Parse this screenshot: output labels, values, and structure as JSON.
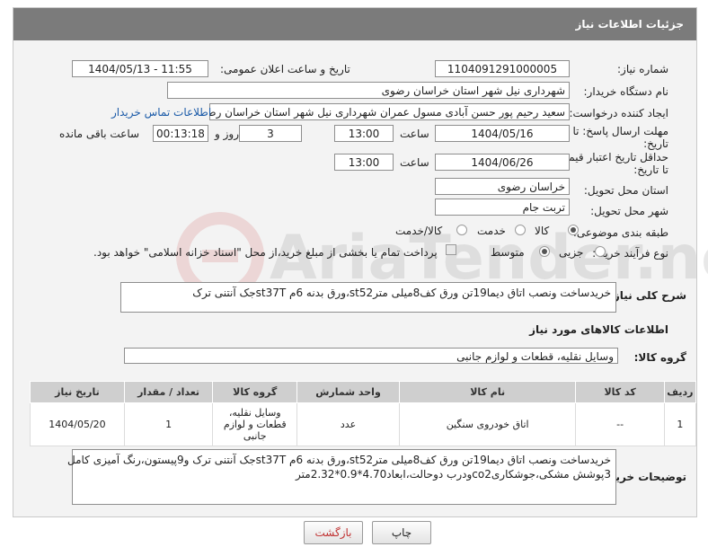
{
  "header": {
    "title": "جزئیات اطلاعات نیاز"
  },
  "fields": {
    "need_number_label": "شماره نیاز:",
    "need_number": "1104091291000005",
    "announce_label": "تاریخ و ساعت اعلان عمومی:",
    "announce_value": "1404/05/13 - 11:55",
    "buyer_org_label": "نام دستگاه خریدار:",
    "buyer_org": "شهرداری نیل شهر استان خراسان رضوی",
    "creator_label": "ایجاد کننده درخواست:",
    "creator": "سعید رحیم پور حسن آبادی مسول عمران شهرداری نیل شهر استان خراسان رضوی",
    "contact_link": "اطلاعات تماس خریدار",
    "reply_deadline_label_1": "مهلت ارسال پاسخ: تا",
    "reply_deadline_label_2": "تاریخ:",
    "reply_date": "1404/05/16",
    "time_label": "ساعت",
    "reply_time": "13:00",
    "days_value": "3",
    "days_label": "روز و",
    "remaining_value": "00:13:18",
    "remaining_label": "ساعت باقی مانده",
    "price_deadline_label_1": "حداقل تاریخ اعتبار قیمت:",
    "price_deadline_label_2": "تا تاریخ:",
    "price_date": "1404/06/26",
    "price_time": "13:00",
    "province_label": "استان محل تحویل:",
    "province": "خراسان رضوی",
    "city_label": "شهر محل تحویل:",
    "city": "تربت جام",
    "category_label": "طبقه بندی موضوعی:",
    "category_options": [
      "کالا",
      "خدمت",
      "کالا/خدمت"
    ],
    "process_label": "نوع فرآیند خرید :",
    "process_options": [
      "جزیی",
      "متوسط"
    ],
    "payment_note": "پرداخت تمام یا بخشی از مبلغ خرید،از محل \"اسناد خزانه اسلامی\" خواهد بود."
  },
  "summary": {
    "label": "شرح کلی نیاز:",
    "text": "خریدساخت ونصب اتاق دیما19تن ورق کف8میلی مترst52،ورق بدنه 6م st37Tجک آنتنی ترک"
  },
  "goods": {
    "section_title": "اطلاعات کالاهای مورد نیاز",
    "group_label": "گروه کالا:",
    "group_value": "وسایل نقلیه، قطعات و لوازم جانبی",
    "columns": [
      "ردیف",
      "کد کالا",
      "نام کالا",
      "واحد شمارش",
      "گروه کالا",
      "تعداد / مقدار",
      "تاریخ نیاز"
    ],
    "rows": [
      {
        "row": "1",
        "code": "--",
        "name": "اتاق خودروی سنگین",
        "unit": "عدد",
        "group": "وسایل نقلیه، قطعات و لوازم جانبی",
        "qty": "1",
        "date": "1404/05/20"
      }
    ]
  },
  "buyer_notes": {
    "label": "توضیحات خریدار:",
    "line1": "خریدساخت ونصب اتاق دیما19تن ورق کف8میلی مترst52،ورق بدنه 6م st37Tجک آنتنی ترک و9پیستون،رنگ آمیزی کامل",
    "line2": "3پوشش مشکی،جوشکاریco2ودرب دوحالت،ابعاد4.70*0.9*2.32متر"
  },
  "buttons": {
    "print": "چاپ",
    "back": "بازگشت"
  },
  "watermark": {
    "text": "AriaTender.neT"
  },
  "colors": {
    "header_bg": "#7b7b7b",
    "link": "#1a5aa8",
    "back_button_text": "#c03030"
  }
}
